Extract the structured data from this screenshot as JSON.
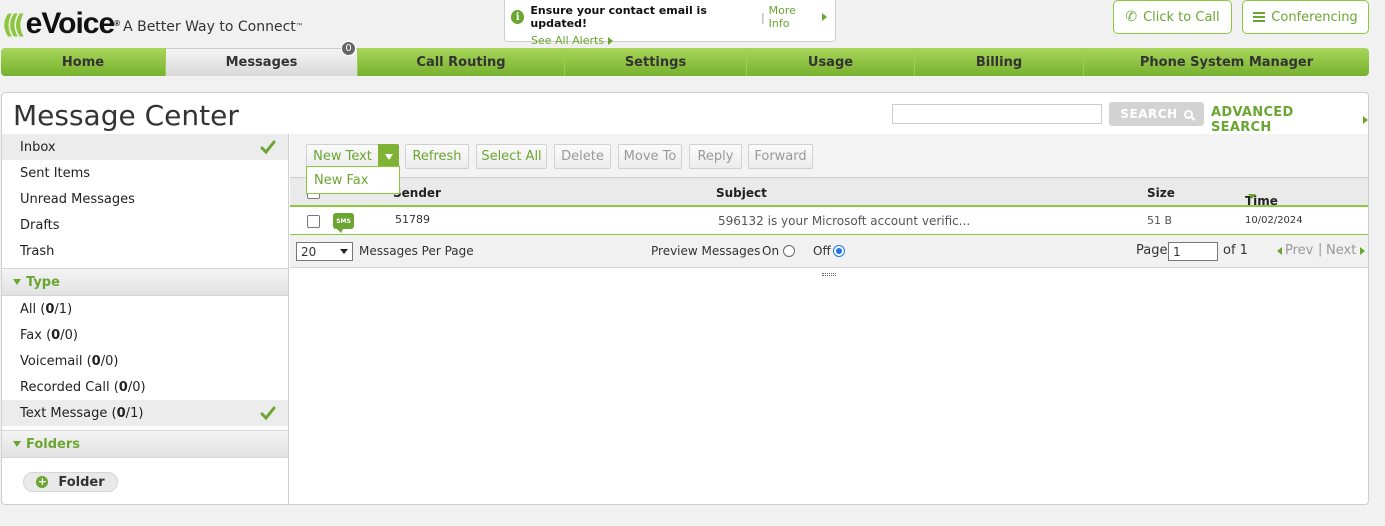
{
  "header": {
    "logo_brand": "eVoice",
    "logo_tm": "®",
    "tagline": "A Better Way to Connect",
    "tagline_tm": "™",
    "alert_text": "Ensure your contact email is updated!",
    "alert_more_info": "More Info",
    "alert_see_all": "See All Alerts",
    "click_to_call": "Click to Call",
    "conferencing": "Conferencing"
  },
  "nav": {
    "items": [
      {
        "label": "Home"
      },
      {
        "label": "Messages",
        "badge": "0"
      },
      {
        "label": "Call Routing"
      },
      {
        "label": "Settings"
      },
      {
        "label": "Usage"
      },
      {
        "label": "Billing"
      },
      {
        "label": "Phone System Manager"
      }
    ]
  },
  "panel": {
    "title": "Message Center",
    "search_placeholder": "",
    "search_button": "SEARCH",
    "advanced_search": "ADVANCED SEARCH"
  },
  "sidebar": {
    "mailboxes": [
      {
        "label": "Inbox",
        "selected": true
      },
      {
        "label": "Sent Items"
      },
      {
        "label": "Unread Messages"
      },
      {
        "label": "Drafts"
      },
      {
        "label": "Trash"
      }
    ],
    "type_section": "Type",
    "types": [
      {
        "label": "All",
        "unread": "0",
        "total": "1"
      },
      {
        "label": "Fax",
        "unread": "0",
        "total": "0"
      },
      {
        "label": "Voicemail",
        "unread": "0",
        "total": "0"
      },
      {
        "label": "Recorded Call",
        "unread": "0",
        "total": "0"
      },
      {
        "label": "Text Message",
        "unread": "0",
        "total": "1",
        "selected": true
      }
    ],
    "folders_section": "Folders",
    "folder_button": "Folder"
  },
  "toolbar": {
    "new_text": "New Text",
    "new_fax": "New Fax",
    "refresh": "Refresh",
    "select_all": "Select All",
    "delete": "Delete",
    "move_to": "Move To",
    "reply": "Reply",
    "forward": "Forward"
  },
  "table": {
    "headers": {
      "sender": "Sender",
      "subject": "Subject",
      "size": "Size",
      "time": "Time"
    },
    "rows": [
      {
        "type_icon": "SMS",
        "sender": "51789",
        "subject": "596132 is your Microsoft account verific...",
        "size": "51 B",
        "time": "10/02/2024"
      }
    ]
  },
  "pager": {
    "per_page_value": "20",
    "per_page_label": "Messages Per Page",
    "preview_label": "Preview Messages",
    "on_label": "On",
    "off_label": "Off",
    "preview_on": false,
    "page_label": "Page",
    "page_value": "1",
    "of_label": "of 1",
    "prev": "Prev",
    "next": "Next",
    "sep": "|"
  },
  "colors": {
    "accent_green": "#6aa631",
    "nav_green": "#8dc63f",
    "badge_gray": "#666666"
  }
}
